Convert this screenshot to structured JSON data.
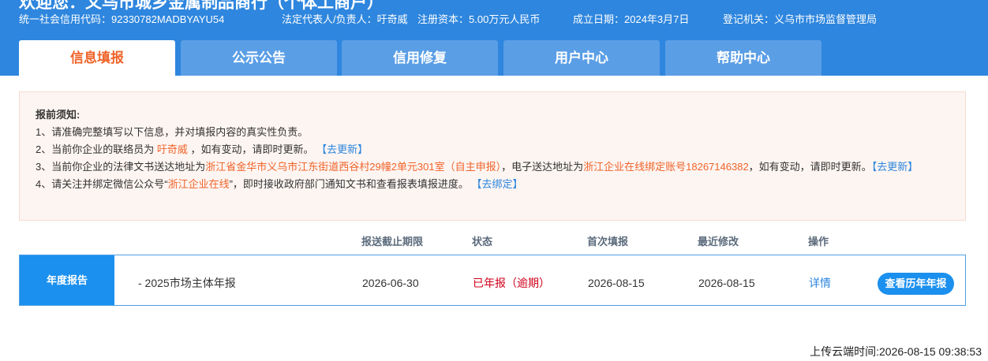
{
  "header": {
    "welcome": "欢迎您：义乌市城乡金属制品商行（个体工商户）",
    "info": [
      {
        "label": "统一社会信用代码：",
        "value": "92330782MADBYAYU54"
      },
      {
        "label": "法定代表人/负责人：",
        "value": "吁奇威"
      },
      {
        "label": "注册资本：",
        "value": "5.00万元人民币"
      },
      {
        "label": "成立日期：",
        "value": "2024年3月7日"
      },
      {
        "label": "登记机关：",
        "value": "义乌市市场监督管理局"
      }
    ]
  },
  "tabs": [
    {
      "label": "信息填报",
      "active": true
    },
    {
      "label": "公示公告",
      "active": false
    },
    {
      "label": "信用修复",
      "active": false
    },
    {
      "label": "用户中心",
      "active": false
    },
    {
      "label": "帮助中心",
      "active": false
    }
  ],
  "notice": {
    "title": "报前须知:",
    "line1": "1、请准确完整填写以下信息，并对填报内容的真实性负责。",
    "line2_prefix": "2、当前你企业的联络员为",
    "liaison": "吁奇威",
    "line2_suffix": "，如有变动，请即时更新。",
    "update_link": "【去更新】",
    "line3_prefix": "3、当前你企业的法律文书送达地址为",
    "address": "浙江省金华市义乌市江东街道西谷村29幢2单元301室（自主申报）",
    "line3_mid": "，电子送达地址为",
    "e_address": "浙江企业在线绑定账号18267146382",
    "line3_suffix": "，如有变动，请即时更新。",
    "update_link2": "【去更新】",
    "line4_prefix": "4、请关注并绑定微信公众号“",
    "wechat": "浙江企业在线",
    "line4_suffix": "”，即时接收政府部门通知文书和查看报表填报进度。",
    "bind_link": "【去绑定】"
  },
  "table": {
    "headers": {
      "deadline": "报送截止期限",
      "status": "状态",
      "first": "首次填报",
      "modified": "最近修改",
      "action": "操作"
    },
    "row": {
      "label": "年度报告",
      "name": "- 2025市场主体年报",
      "deadline": "2026-06-30",
      "status": "已年报（逾期）",
      "first": "2026-08-15",
      "modified": "2026-08-15",
      "detail": "详情",
      "history": "查看历年年报"
    }
  },
  "upload_time": "上传云端时间:2026-08-15 09:38:53",
  "colors": {
    "primary": "#2e86de",
    "accent": "#f0642a",
    "danger": "#d0021b",
    "notice_bg": "#fdf5f2"
  }
}
